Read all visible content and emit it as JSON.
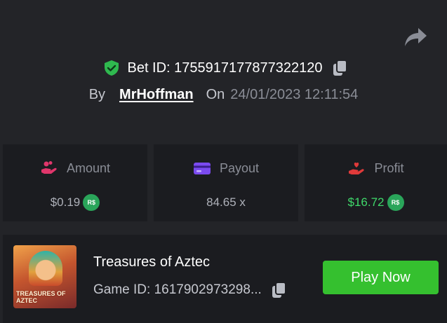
{
  "header": {
    "bet_label": "Bet ID: 1755917177877322120",
    "by_label": "By",
    "username": "MrHoffman",
    "on_label": "On",
    "datetime": "24/01/2023 12:11:54"
  },
  "stats": {
    "amount": {
      "label": "Amount",
      "value": "$0.19",
      "currency": "R$"
    },
    "payout": {
      "label": "Payout",
      "value": "84.65 x"
    },
    "profit": {
      "label": "Profit",
      "value": "$16.72",
      "currency": "R$"
    }
  },
  "game": {
    "name": "Treasures of Aztec",
    "id_text": "Game ID: 1617902973298...",
    "thumbnail_text": "TREASURES OF AZTEC",
    "play_label": "Play Now"
  },
  "icons": {
    "share": "share-icon",
    "verified": "shield-check-icon",
    "copy": "copy-icon",
    "amount": "hand-coins-icon",
    "payout": "credit-card-icon",
    "profit": "hand-heart-icon"
  },
  "colors": {
    "background": "#232428",
    "card": "#1b1c20",
    "accent_green": "#35c02f",
    "profit_green": "#3fd86a",
    "amount_icon": "#e0366b",
    "payout_icon": "#7b4bef",
    "profit_icon": "#e03a3a"
  }
}
